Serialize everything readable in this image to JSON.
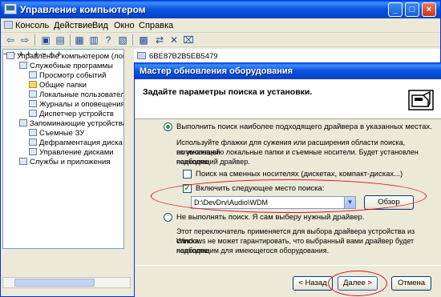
{
  "mmc": {
    "title": "Управление компьютером",
    "caption_buttons": {
      "minimize": "_",
      "maximize": "□",
      "close": "×"
    },
    "menu": [
      "Консоль",
      "Действие",
      "Вид",
      "Окно",
      "Справка"
    ],
    "tree": {
      "root": "Управление компьютером (локал",
      "items": [
        "Служебные программы",
        "Просмотр событий",
        "Общие папки",
        "Локальные пользовател",
        "Журналы и оповещения пр",
        "Диспетчер устройств",
        "Запоминающие устройства",
        "Съемные ЗУ",
        "Дефрагментация диска",
        "Управление дисками",
        "Службы и приложения"
      ]
    },
    "right_pane": {
      "computer_name": "6BE87B2B5EB5479"
    }
  },
  "wizard": {
    "title": "Мастер обновления оборудования",
    "header": "Задайте параметры поиска и установки.",
    "option_search": {
      "label": "Выполнить поиск наиболее подходящего драйвера в указанных местах.",
      "checked": true,
      "description": [
        "Используйте флажки для сужения или расширения области поиска, включающей",
        "по умолчанию локальные папки и съемные носители. Будет установлен наиболее",
        "подходящий драйвер."
      ]
    },
    "check_removable": {
      "label": "Поиск на сменных носителях (дискетах, компакт-дисках...)",
      "checked": false
    },
    "check_location": {
      "label": "Включить следующее место поиска:",
      "checked": true,
      "mark": "✓"
    },
    "path_value": "D:\\DevDrv\\Audio\\WDM",
    "browse_label": "Обзор",
    "option_manual": {
      "label": "Не выполнять поиск. Я сам выберу нужный драйвер.",
      "checked": false,
      "description": [
        "Этот переключатель применяется для выбора драйвера устройства из списка.",
        "Windows не может гарантировать, что выбранный вами драйвер будет наиболее",
        "подходящим для имеющегося оборудования."
      ]
    },
    "buttons": {
      "back": "< Назад",
      "next": "Далее >",
      "cancel": "Отмена"
    }
  },
  "colors": {
    "title_blue": "#0c55e0",
    "dialog_face": "#ece9d8",
    "highlight_red": "#d9131c"
  }
}
